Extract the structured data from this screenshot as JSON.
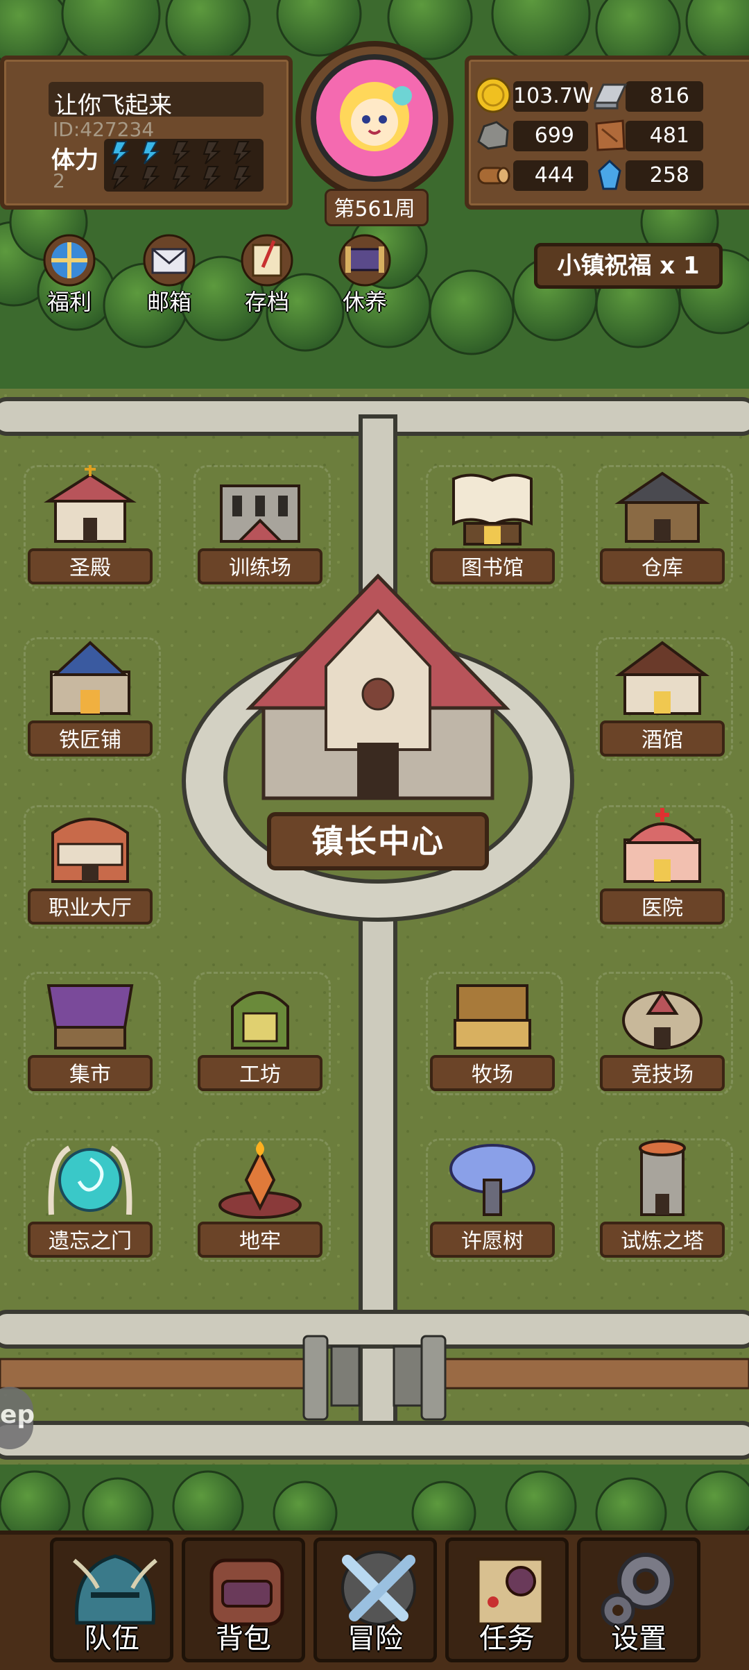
{
  "player": {
    "name": "让你飞起来",
    "id_text": "ID:427234",
    "stamina_label": "体力",
    "stamina_value": "2",
    "week_label": "第561周"
  },
  "resources": [
    {
      "icon": "gold-coin-icon",
      "value": "103.7W"
    },
    {
      "icon": "iron-ingot-icon",
      "value": "816"
    },
    {
      "icon": "stone-ore-icon",
      "value": "699"
    },
    {
      "icon": "leather-icon",
      "value": "481"
    },
    {
      "icon": "wood-log-icon",
      "value": "444"
    },
    {
      "icon": "crystal-icon",
      "value": "258"
    }
  ],
  "top_menu": [
    {
      "icon": "welfare-wheel-icon",
      "label": "福利"
    },
    {
      "icon": "mailbox-icon",
      "label": "邮箱"
    },
    {
      "icon": "scroll-save-icon",
      "label": "存档"
    },
    {
      "icon": "rest-scroll-icon",
      "label": "休养"
    }
  ],
  "blessing": {
    "label": "小镇祝福 x 1"
  },
  "center": {
    "label": "镇长中心"
  },
  "buildings": [
    {
      "name": "圣殿"
    },
    {
      "name": "训练场"
    },
    {
      "name": "图书馆"
    },
    {
      "name": "仓库"
    },
    {
      "name": "铁匠铺"
    },
    {
      "name": "酒馆"
    },
    {
      "name": "职业大厅"
    },
    {
      "name": "医院"
    },
    {
      "name": "集市"
    },
    {
      "name": "工坊"
    },
    {
      "name": "牧场"
    },
    {
      "name": "竞技场"
    },
    {
      "name": "遗忘之门"
    },
    {
      "name": "地牢"
    },
    {
      "name": "许愿树"
    },
    {
      "name": "试炼之塔"
    }
  ],
  "bottom_nav": [
    {
      "icon": "helmet-icon",
      "label": "队伍"
    },
    {
      "icon": "backpack-icon",
      "label": "背包"
    },
    {
      "icon": "crossed-swords-icon",
      "label": "冒险"
    },
    {
      "icon": "quest-scroll-icon",
      "label": "任务"
    },
    {
      "icon": "gear-icon",
      "label": "设置"
    }
  ],
  "side_tab": {
    "label": "ep"
  },
  "colors": {
    "grass": "#6b7d3c",
    "path": "#c9c7b8",
    "wood": "#6b4428",
    "forest": "#2f5a2a",
    "stamina": "#39b6e8"
  }
}
